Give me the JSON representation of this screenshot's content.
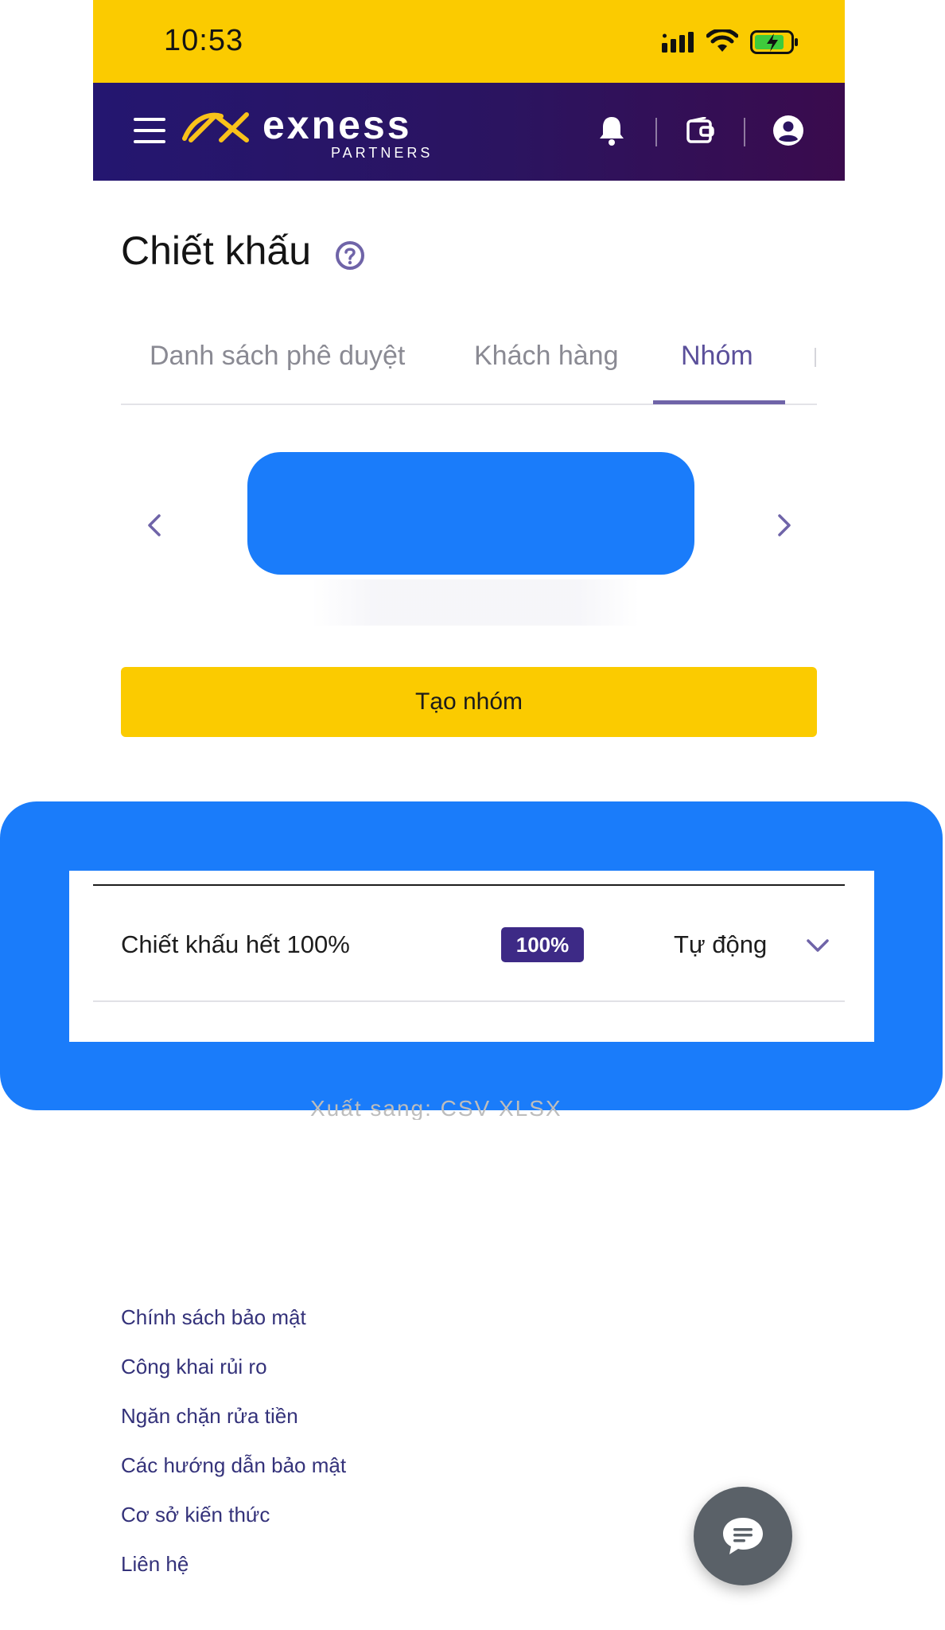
{
  "status_bar": {
    "time": "10:53",
    "background": "#fbcb00",
    "icons": [
      "signal-icon",
      "wifi-icon",
      "battery-charging-icon"
    ]
  },
  "header": {
    "brand": "exness",
    "brand_sub": "PARTNERS",
    "icons": [
      "menu-icon",
      "bell-icon",
      "wallet-icon",
      "account-icon"
    ],
    "gradient": [
      "#241670",
      "#3a0b4d"
    ]
  },
  "page": {
    "title": "Chiết khấu"
  },
  "tabs": [
    {
      "label": "Danh sách phê duyệt",
      "active": false
    },
    {
      "label": "Khách hàng",
      "active": false
    },
    {
      "label": "Nhóm",
      "active": true
    }
  ],
  "create_group": {
    "label": "Tạo nhóm",
    "color": "#fbcb00"
  },
  "rebate_row": {
    "name": "Chiết khấu hết 100%",
    "badge": "100%",
    "mode": "Tự động"
  },
  "export": {
    "partial_text": "Xuất sang:   CSV   XLSX"
  },
  "footer": {
    "links": [
      "Chính sách bảo mật",
      "Công khai rủi ro",
      "Ngăn chặn rửa tiền",
      "Các hướng dẫn bảo mật",
      "Cơ sở kiến thức",
      "Liên hệ"
    ]
  },
  "colors": {
    "accent_yellow": "#fbcb00",
    "tab_active": "#5a4f9a",
    "badge_purple": "#3d2a86",
    "redaction_blue": "#1a7cfa",
    "link_color": "#34327a"
  }
}
